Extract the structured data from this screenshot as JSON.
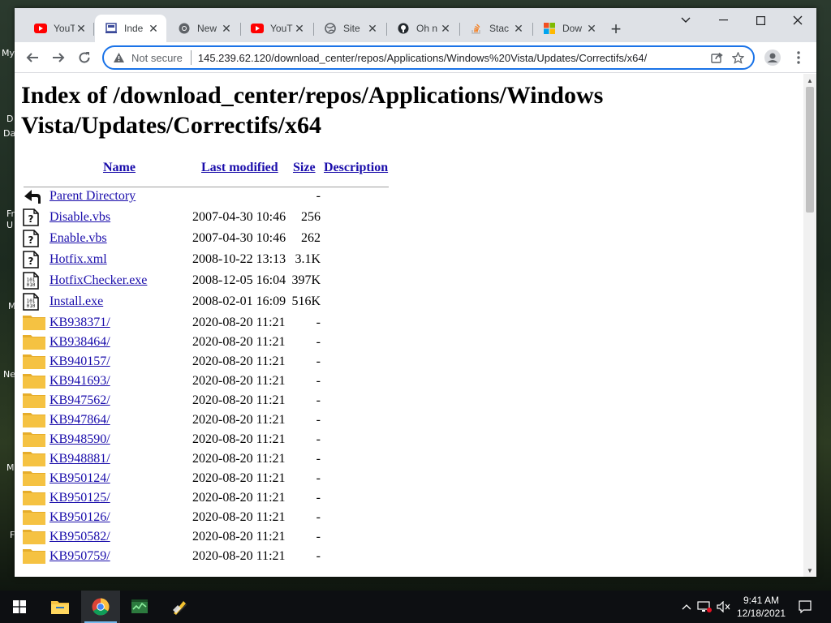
{
  "browser": {
    "tabs": [
      {
        "title": "YouT",
        "icon": "youtube-icon",
        "active": false
      },
      {
        "title": "Inde",
        "icon": "page-icon",
        "active": true
      },
      {
        "title": "New",
        "icon": "chrome-icon",
        "active": false
      },
      {
        "title": "YouT",
        "icon": "youtube-icon",
        "active": false
      },
      {
        "title": "Site",
        "icon": "globe-icon",
        "active": false
      },
      {
        "title": "Oh n",
        "icon": "github-icon",
        "active": false
      },
      {
        "title": "Stac",
        "icon": "stackoverflow-icon",
        "active": false
      },
      {
        "title": "Dow",
        "icon": "microsoft-icon",
        "active": false
      }
    ],
    "new_tab_label": "+",
    "address_bar": {
      "security_label": "Not secure",
      "url": "145.239.62.120/download_center/repos/Applications/Windows%20Vista/Updates/Correctifs/x64/"
    }
  },
  "page": {
    "title": "Index of /download_center/repos/Applications/Windows Vista/Updates/Correctifs/x64",
    "columns": {
      "name": "Name",
      "modified": "Last modified",
      "size": "Size",
      "description": "Description"
    },
    "entries": [
      {
        "icon": "back-icon",
        "name": "Parent Directory",
        "modified": "",
        "size": "-"
      },
      {
        "icon": "unknown-file-icon",
        "name": "Disable.vbs",
        "modified": "2007-04-30 10:46",
        "size": "256"
      },
      {
        "icon": "unknown-file-icon",
        "name": "Enable.vbs",
        "modified": "2007-04-30 10:46",
        "size": "262"
      },
      {
        "icon": "unknown-file-icon",
        "name": "Hotfix.xml",
        "modified": "2008-10-22 13:13",
        "size": "3.1K"
      },
      {
        "icon": "binary-file-icon",
        "name": "HotfixChecker.exe",
        "modified": "2008-12-05 16:04",
        "size": "397K"
      },
      {
        "icon": "binary-file-icon",
        "name": "Install.exe",
        "modified": "2008-02-01 16:09",
        "size": "516K"
      },
      {
        "icon": "folder-icon",
        "name": "KB938371/",
        "modified": "2020-08-20 11:21",
        "size": "-"
      },
      {
        "icon": "folder-icon",
        "name": "KB938464/",
        "modified": "2020-08-20 11:21",
        "size": "-"
      },
      {
        "icon": "folder-icon",
        "name": "KB940157/",
        "modified": "2020-08-20 11:21",
        "size": "-"
      },
      {
        "icon": "folder-icon",
        "name": "KB941693/",
        "modified": "2020-08-20 11:21",
        "size": "-"
      },
      {
        "icon": "folder-icon",
        "name": "KB947562/",
        "modified": "2020-08-20 11:21",
        "size": "-"
      },
      {
        "icon": "folder-icon",
        "name": "KB947864/",
        "modified": "2020-08-20 11:21",
        "size": "-"
      },
      {
        "icon": "folder-icon",
        "name": "KB948590/",
        "modified": "2020-08-20 11:21",
        "size": "-"
      },
      {
        "icon": "folder-icon",
        "name": "KB948881/",
        "modified": "2020-08-20 11:21",
        "size": "-"
      },
      {
        "icon": "folder-icon",
        "name": "KB950124/",
        "modified": "2020-08-20 11:21",
        "size": "-"
      },
      {
        "icon": "folder-icon",
        "name": "KB950125/",
        "modified": "2020-08-20 11:21",
        "size": "-"
      },
      {
        "icon": "folder-icon",
        "name": "KB950126/",
        "modified": "2020-08-20 11:21",
        "size": "-"
      },
      {
        "icon": "folder-icon",
        "name": "KB950582/",
        "modified": "2020-08-20 11:21",
        "size": "-"
      },
      {
        "icon": "folder-icon",
        "name": "KB950759/",
        "modified": "2020-08-20 11:21",
        "size": "-"
      }
    ]
  },
  "desktop": {
    "labels": [
      "My",
      "D",
      "Da",
      "Fr",
      "U",
      "M",
      "Ne",
      "M",
      "F"
    ]
  },
  "taskbar": {
    "apps": [
      "file-explorer-icon",
      "chrome-icon",
      "task-manager-icon",
      "tool-icon"
    ],
    "time": "9:41 AM",
    "date": "12/18/2021"
  },
  "colors": {
    "link": "#1a0dab",
    "accent": "#1a73e8",
    "folder": "#f5c242"
  }
}
